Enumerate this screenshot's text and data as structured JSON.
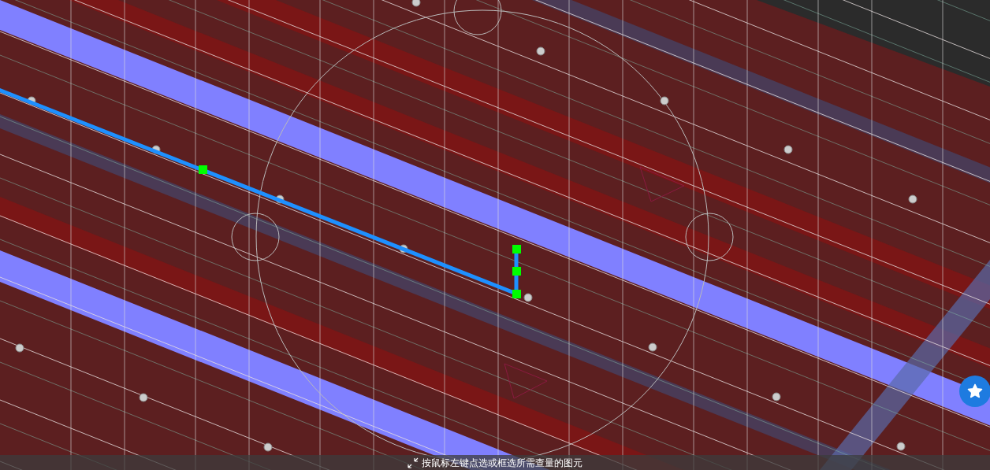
{
  "status_bar": {
    "hint": "按鼠标左键点选或框选所需查量的图元"
  }
}
